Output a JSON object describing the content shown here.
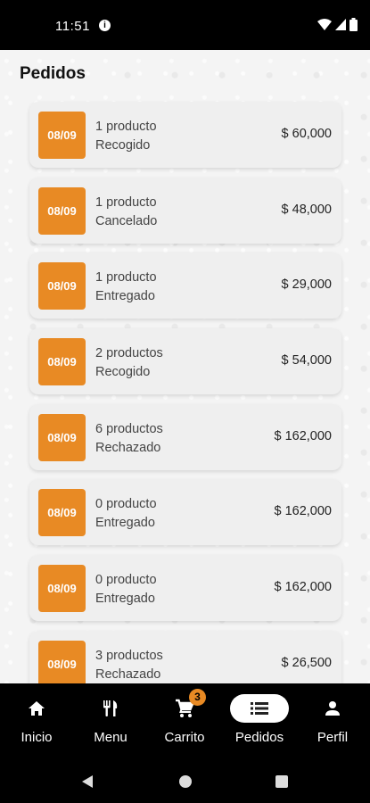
{
  "status": {
    "time": "11:51"
  },
  "page": {
    "title": "Pedidos"
  },
  "orders": [
    {
      "date": "08/09",
      "items": "1 producto",
      "status": "Recogido",
      "price": "$ 60,000"
    },
    {
      "date": "08/09",
      "items": "1 producto",
      "status": "Cancelado",
      "price": "$ 48,000"
    },
    {
      "date": "08/09",
      "items": "1 producto",
      "status": "Entregado",
      "price": "$ 29,000"
    },
    {
      "date": "08/09",
      "items": "2 productos",
      "status": "Recogido",
      "price": "$ 54,000"
    },
    {
      "date": "08/09",
      "items": "6 productos",
      "status": "Rechazado",
      "price": "$ 162,000"
    },
    {
      "date": "08/09",
      "items": "0 producto",
      "status": "Entregado",
      "price": "$ 162,000"
    },
    {
      "date": "08/09",
      "items": "0 producto",
      "status": "Entregado",
      "price": "$ 162,000"
    },
    {
      "date": "08/09",
      "items": "3 productos",
      "status": "Rechazado",
      "price": "$ 26,500"
    }
  ],
  "nav": {
    "items": [
      {
        "label": "Inicio",
        "icon": "home-icon"
      },
      {
        "label": "Menu",
        "icon": "utensils-icon"
      },
      {
        "label": "Carrito",
        "icon": "cart-icon",
        "badge": "3"
      },
      {
        "label": "Pedidos",
        "icon": "list-icon",
        "active": true
      },
      {
        "label": "Perfil",
        "icon": "person-icon"
      }
    ]
  },
  "colors": {
    "accent": "#e88a24",
    "card": "#efefef",
    "background": "#f4f4f4"
  }
}
